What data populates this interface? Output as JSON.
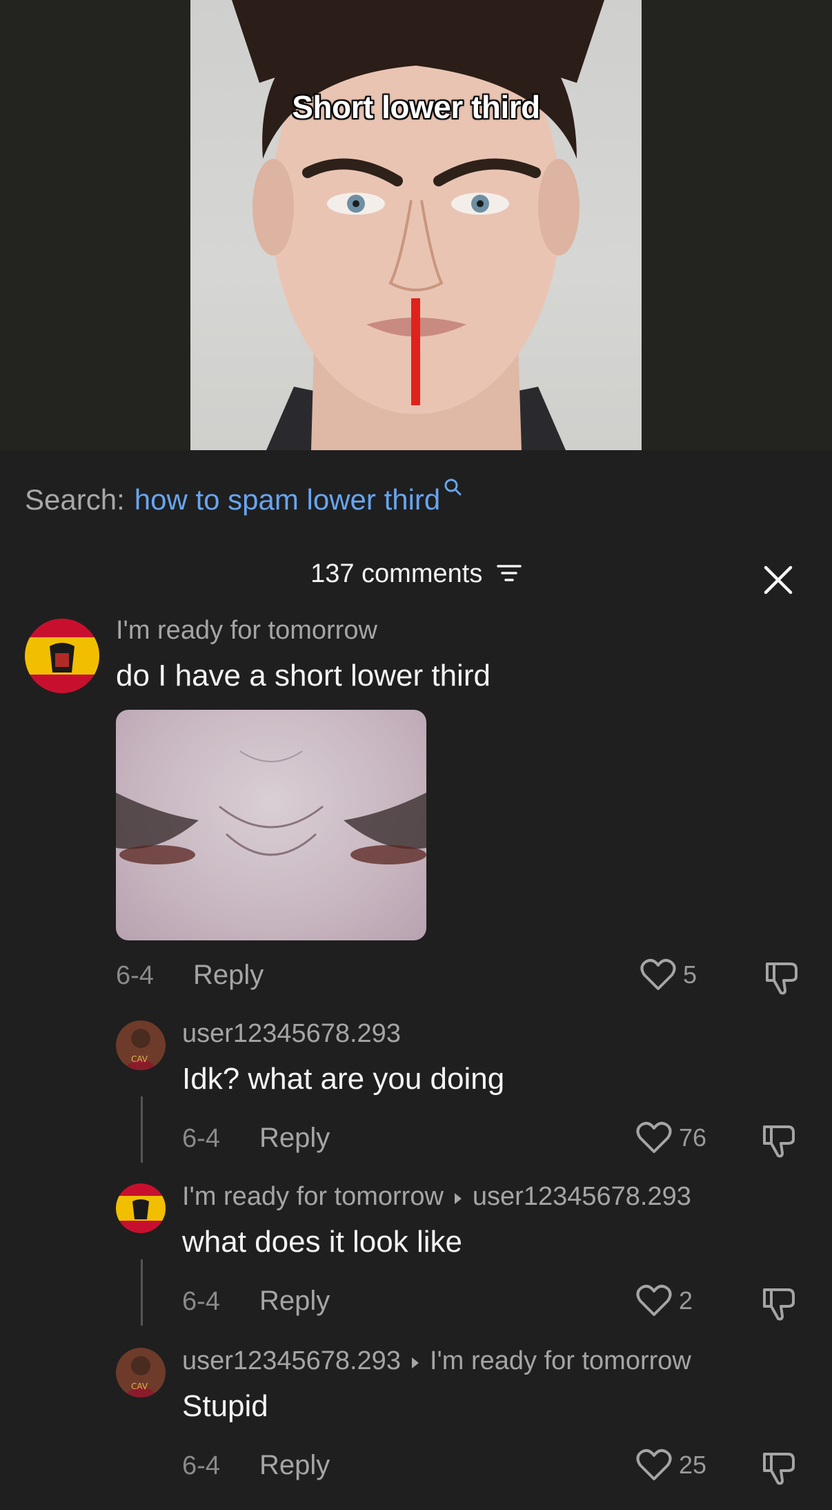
{
  "video": {
    "overlay_text": "Short lower third"
  },
  "search": {
    "label": "Search:",
    "term": "how to spam lower third"
  },
  "comments_header": {
    "count_label": "137 comments"
  },
  "comments": [
    {
      "author": "I'm ready for tomorrow",
      "text": "do I have a short lower third",
      "date": "6-4",
      "reply_label": "Reply",
      "likes": "5",
      "has_image": true
    },
    {
      "author": "user12345678.293",
      "text": "Idk? what are you doing",
      "date": "6-4",
      "reply_label": "Reply",
      "likes": "76"
    },
    {
      "author": "I'm ready for tomorrow",
      "reply_to": "user12345678.293",
      "text": "what does it look like",
      "date": "6-4",
      "reply_label": "Reply",
      "likes": "2"
    },
    {
      "author": "user12345678.293",
      "reply_to": "I'm ready for tomorrow",
      "text": "Stupid",
      "date": "6-4",
      "reply_label": "Reply",
      "likes": "25"
    }
  ],
  "colors": {
    "accent_link": "#67a5ef",
    "background": "#1f1f1f",
    "red_line": "#e0221c"
  },
  "icons": [
    "search-icon",
    "filter-icon",
    "close-icon",
    "heart-icon",
    "dislike-icon",
    "triangle-right-icon"
  ]
}
